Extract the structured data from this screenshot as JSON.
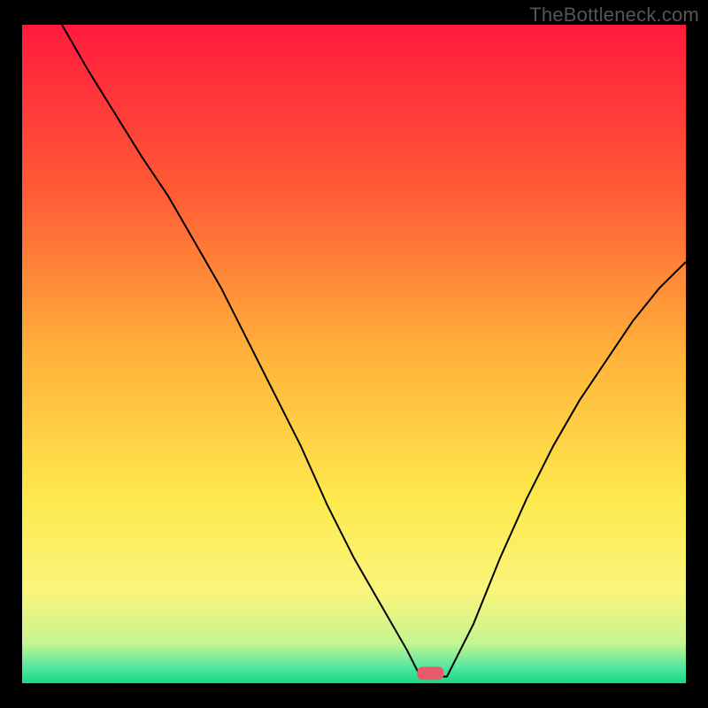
{
  "watermark": "TheBottleneck.com",
  "chart_data": {
    "type": "line",
    "title": "",
    "xlabel": "",
    "ylabel": "",
    "xlim": [
      0,
      100
    ],
    "ylim": [
      0,
      100
    ],
    "background_vertical_gradient": [
      {
        "pos": 0.0,
        "color": "#ff1a3d"
      },
      {
        "pos": 0.25,
        "color": "#ff5a35"
      },
      {
        "pos": 0.5,
        "color": "#ffb23a"
      },
      {
        "pos": 0.72,
        "color": "#fde94d"
      },
      {
        "pos": 0.86,
        "color": "#faf57c"
      },
      {
        "pos": 0.94,
        "color": "#c5f590"
      },
      {
        "pos": 0.975,
        "color": "#55e7a0"
      },
      {
        "pos": 1.0,
        "color": "#17d984"
      }
    ],
    "series": [
      {
        "name": "curve",
        "x": [
          6,
          10,
          14,
          18,
          22,
          26,
          30,
          34,
          38,
          42,
          46,
          50,
          54,
          58,
          60,
          64,
          68,
          72,
          76,
          80,
          84,
          88,
          92,
          96,
          100
        ],
        "y": [
          100,
          93,
          86.5,
          80,
          74,
          67,
          60,
          52,
          44,
          36,
          27,
          19,
          12,
          5,
          1,
          1,
          9,
          19,
          28,
          36,
          43,
          49,
          55,
          60,
          64
        ]
      }
    ],
    "marker": {
      "name": "optimal-point",
      "x_range": [
        59.5,
        63.5
      ],
      "y": 1.5,
      "pill_color": "#e65c6a"
    }
  }
}
